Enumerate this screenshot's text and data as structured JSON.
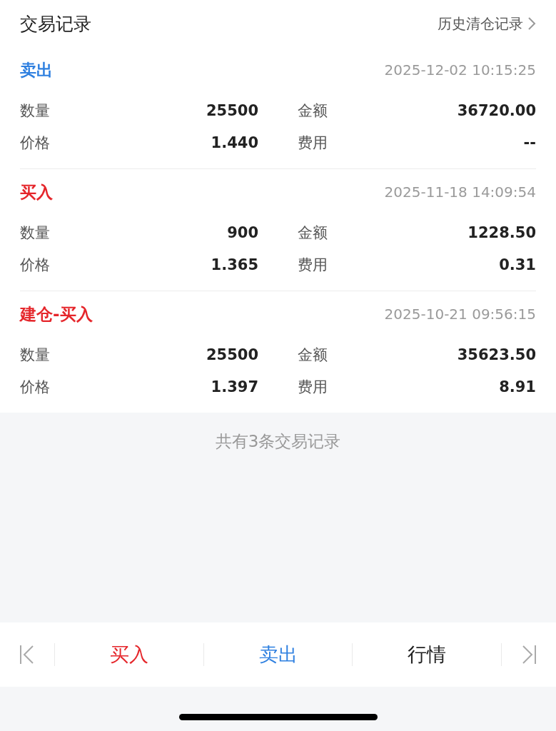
{
  "header": {
    "title": "交易记录",
    "link": "历史清仓记录"
  },
  "records": [
    {
      "type": "卖出",
      "kind": "sell",
      "time": "2025-12-02 10:15:25",
      "fields": [
        {
          "label": "数量",
          "value": "25500"
        },
        {
          "label": "金额",
          "value": "36720.00"
        },
        {
          "label": "价格",
          "value": "1.440"
        },
        {
          "label": "费用",
          "value": "--"
        }
      ]
    },
    {
      "type": "买入",
      "kind": "buy",
      "time": "2025-11-18 14:09:54",
      "fields": [
        {
          "label": "数量",
          "value": "900"
        },
        {
          "label": "金额",
          "value": "1228.50"
        },
        {
          "label": "价格",
          "value": "1.365"
        },
        {
          "label": "费用",
          "value": "0.31"
        }
      ]
    },
    {
      "type": "建仓-买入",
      "kind": "buy",
      "time": "2025-10-21 09:56:15",
      "fields": [
        {
          "label": "数量",
          "value": "25500"
        },
        {
          "label": "金额",
          "value": "35623.50"
        },
        {
          "label": "价格",
          "value": "1.397"
        },
        {
          "label": "费用",
          "value": "8.91"
        }
      ]
    }
  ],
  "summary": "共有3条交易记录",
  "bottom_bar": [
    {
      "label": "买入",
      "kind": "buy"
    },
    {
      "label": "卖出",
      "kind": "sell"
    },
    {
      "label": "行情",
      "kind": "quote"
    }
  ]
}
